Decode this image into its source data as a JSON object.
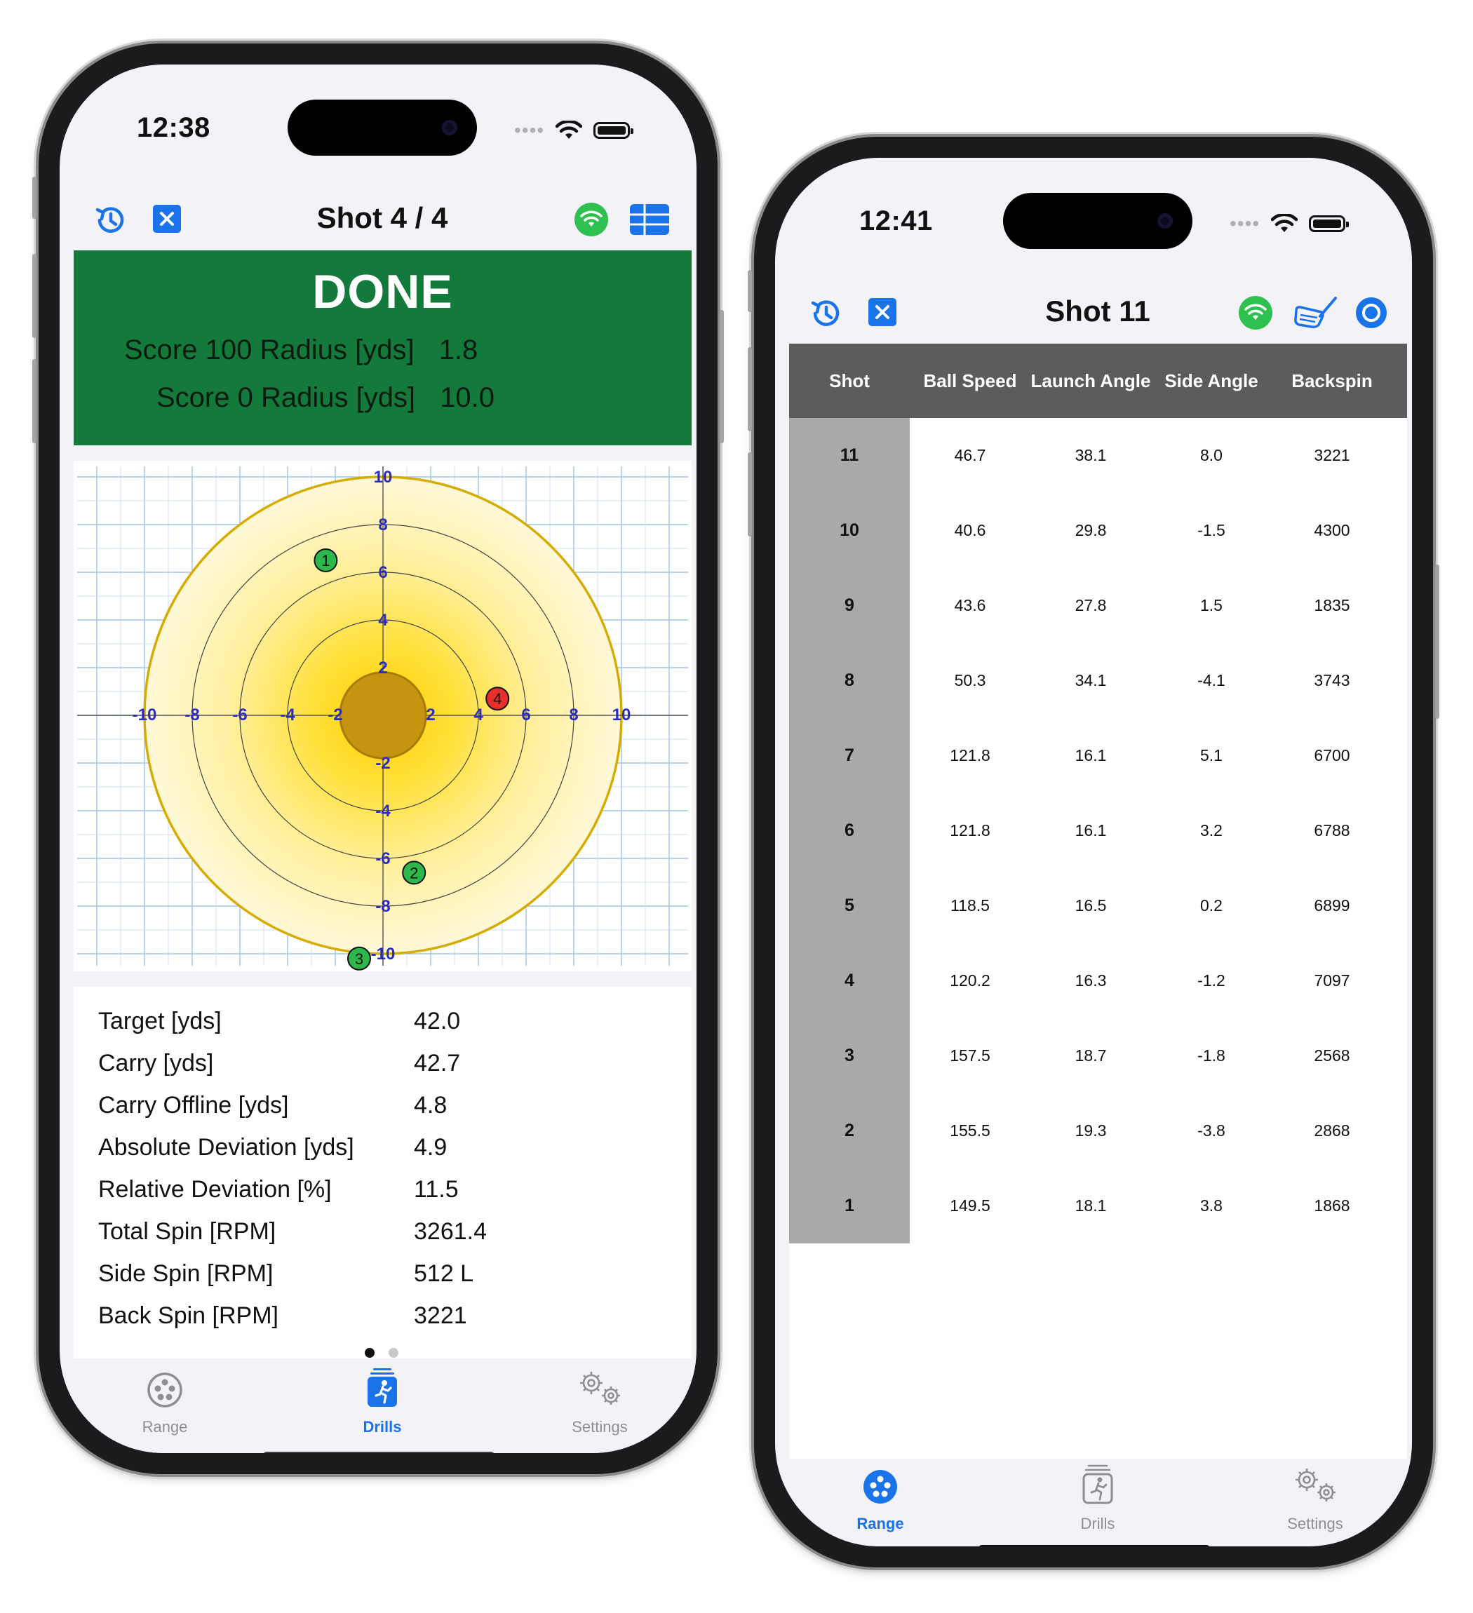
{
  "left_phone": {
    "status": {
      "time": "12:38"
    },
    "nav": {
      "title": "Shot 4 / 4"
    },
    "banner": {
      "status": "DONE",
      "rows": [
        {
          "label": "Score 100 Radius [yds]",
          "value": "1.8"
        },
        {
          "label": "Score 0 Radius [yds]",
          "value": "10.0"
        }
      ]
    },
    "target": {
      "axis_labels_x": [
        "-10",
        "-8",
        "-6",
        "-4",
        "-2",
        "2",
        "4",
        "6",
        "8",
        "10"
      ],
      "axis_labels_y": [
        "10",
        "8",
        "6",
        "4",
        "2",
        "-2",
        "-4",
        "-6",
        "-8",
        "-10"
      ],
      "shots": [
        {
          "label": "1",
          "x": -2.4,
          "y": 6.5,
          "color": "#2db84c"
        },
        {
          "label": "2",
          "x": 1.3,
          "y": -6.6,
          "color": "#2db84c"
        },
        {
          "label": "3",
          "x": -1.0,
          "y": -10.2,
          "color": "#2db84c"
        },
        {
          "label": "4",
          "x": 4.8,
          "y": 0.7,
          "color": "#e8302b"
        }
      ]
    },
    "stats": [
      {
        "label": "Target [yds]",
        "value": "42.0"
      },
      {
        "label": "Carry [yds]",
        "value": "42.7"
      },
      {
        "label": "Carry Offline [yds]",
        "value": "4.8"
      },
      {
        "label": "Absolute Deviation [yds]",
        "value": "4.9"
      },
      {
        "label": "Relative Deviation [%]",
        "value": "11.5"
      },
      {
        "label": "Total Spin [RPM]",
        "value": "3261.4"
      },
      {
        "label": "Side Spin [RPM]",
        "value": "512 L"
      },
      {
        "label": "Back Spin [RPM]",
        "value": "3221"
      }
    ],
    "tabs": {
      "range": "Range",
      "drills": "Drills",
      "settings": "Settings"
    }
  },
  "right_phone": {
    "status": {
      "time": "12:41"
    },
    "nav": {
      "title": "Shot 11"
    },
    "table": {
      "headers": [
        "Shot",
        "Ball Speed",
        "Launch Angle",
        "Side Angle",
        "Backspin"
      ],
      "rows": [
        [
          "11",
          "46.7",
          "38.1",
          "8.0",
          "3221"
        ],
        [
          "10",
          "40.6",
          "29.8",
          "-1.5",
          "4300"
        ],
        [
          "9",
          "43.6",
          "27.8",
          "1.5",
          "1835"
        ],
        [
          "8",
          "50.3",
          "34.1",
          "-4.1",
          "3743"
        ],
        [
          "7",
          "121.8",
          "16.1",
          "5.1",
          "6700"
        ],
        [
          "6",
          "121.8",
          "16.1",
          "3.2",
          "6788"
        ],
        [
          "5",
          "118.5",
          "16.5",
          "0.2",
          "6899"
        ],
        [
          "4",
          "120.2",
          "16.3",
          "-1.2",
          "7097"
        ],
        [
          "3",
          "157.5",
          "18.7",
          "-1.8",
          "2568"
        ],
        [
          "2",
          "155.5",
          "19.3",
          "-3.8",
          "2868"
        ],
        [
          "1",
          "149.5",
          "18.1",
          "3.8",
          "1868"
        ]
      ]
    },
    "tabs": {
      "range": "Range",
      "drills": "Drills",
      "settings": "Settings"
    }
  },
  "colors": {
    "accent_blue": "#1a73e8",
    "banner_green": "#147a3c",
    "wifi_green": "#2ec14f",
    "tab_inactive": "#8e8e93"
  },
  "icons": [
    "history-icon",
    "close-icon",
    "wifi-connected-icon",
    "table-view-icon",
    "club-icon",
    "record-icon",
    "range-icon",
    "drills-icon",
    "settings-icon"
  ]
}
